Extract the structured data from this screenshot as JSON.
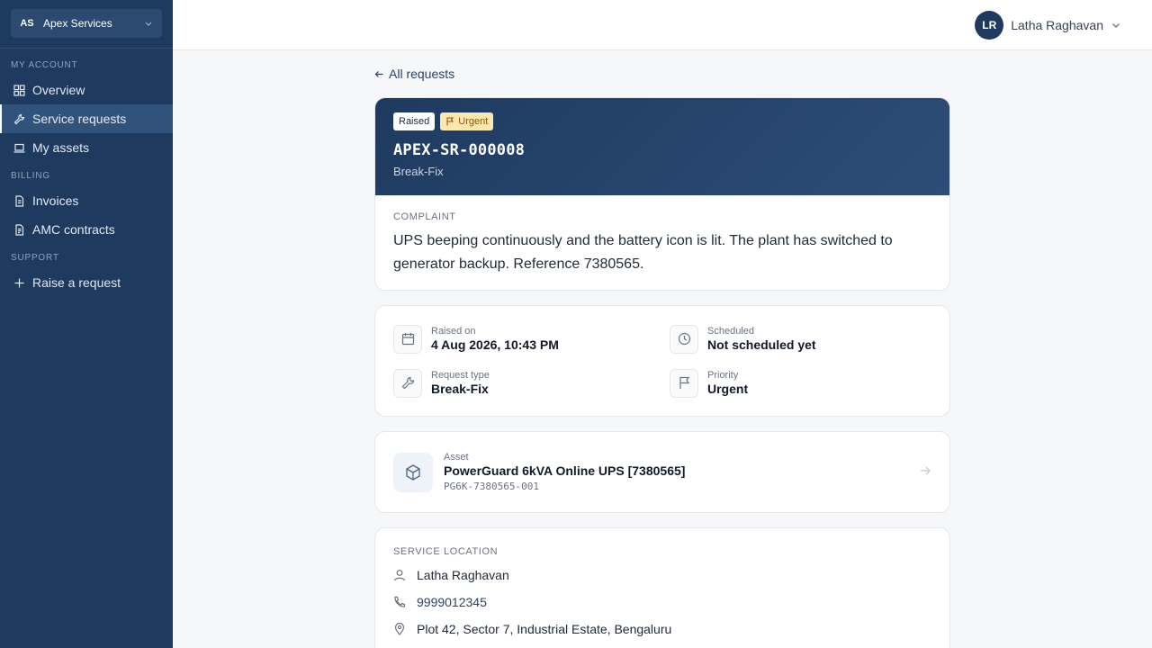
{
  "org": {
    "initials": "AS",
    "name": "Apex Services"
  },
  "sidebar": {
    "sections": [
      {
        "title": "MY ACCOUNT"
      },
      {
        "title": "BILLING"
      },
      {
        "title": "SUPPORT"
      }
    ],
    "items": [
      {
        "label": "Overview",
        "icon": "grid-icon"
      },
      {
        "label": "Service requests",
        "icon": "wrench-icon",
        "active": true
      },
      {
        "label": "My assets",
        "icon": "laptop-icon"
      },
      {
        "label": "Invoices",
        "icon": "document-icon"
      },
      {
        "label": "AMC contracts",
        "icon": "contract-icon"
      },
      {
        "label": "Raise a request",
        "icon": "plus-icon"
      }
    ]
  },
  "user": {
    "initials": "LR",
    "name": "Latha Raghavan"
  },
  "back": {
    "label": "All requests"
  },
  "request": {
    "status": "Raised",
    "priority_badge": "Urgent",
    "id": "APEX-SR-000008",
    "type": "Break-Fix",
    "complaint_label": "COMPLAINT",
    "complaint": "UPS beeping continuously and the battery icon is lit. The plant has switched to generator backup. Reference 7380565."
  },
  "details": {
    "raised_on": {
      "label": "Raised on",
      "value": "4 Aug 2026, 10:43 PM"
    },
    "scheduled": {
      "label": "Scheduled",
      "value": "Not scheduled yet"
    },
    "request_type": {
      "label": "Request type",
      "value": "Break-Fix"
    },
    "priority": {
      "label": "Priority",
      "value": "Urgent"
    }
  },
  "asset": {
    "label": "Asset",
    "name": "PowerGuard 6kVA Online UPS [7380565]",
    "code": "PG6K-7380565-001"
  },
  "location": {
    "label": "SERVICE LOCATION",
    "contact_name": "Latha Raghavan",
    "phone": "9999012345",
    "address": "Plot 42, Sector 7, Industrial Estate, Bengaluru"
  },
  "colors": {
    "sidebar_bg": "#1e3a5f",
    "accent": "#2b4466",
    "urgent_bg": "#fde7b0"
  }
}
